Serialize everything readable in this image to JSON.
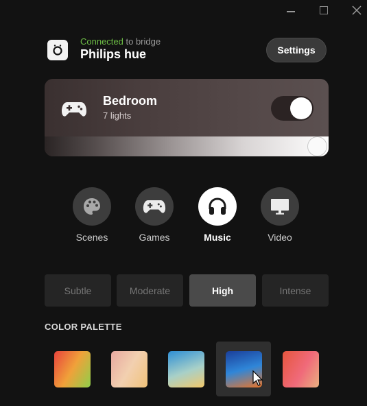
{
  "window": {
    "controls": [
      "minimize",
      "maximize",
      "close"
    ]
  },
  "header": {
    "connected_word": "Connected",
    "connected_suffix": " to bridge",
    "bridge_name": "Philips hue",
    "settings_label": "Settings",
    "bridge_icon": "bridge-icon"
  },
  "room": {
    "name": "Bedroom",
    "subtitle": "7 lights",
    "icon": "gamepad-icon",
    "power_on": true,
    "brightness": 1.0
  },
  "modes": [
    {
      "label": "Scenes",
      "icon": "palette-icon",
      "active": false
    },
    {
      "label": "Games",
      "icon": "gamepad-icon",
      "active": false
    },
    {
      "label": "Music",
      "icon": "headphones-icon",
      "active": true
    },
    {
      "label": "Video",
      "icon": "monitor-icon",
      "active": false
    }
  ],
  "intensity": [
    {
      "label": "Subtle",
      "active": false
    },
    {
      "label": "Moderate",
      "active": false
    },
    {
      "label": "High",
      "active": true
    },
    {
      "label": "Intense",
      "active": false
    }
  ],
  "palette": {
    "title": "COLOR PALETTE",
    "swatches": [
      {
        "colors": [
          "#e8443c",
          "#f0a13a",
          "#8fcf4a"
        ],
        "active": false
      },
      {
        "colors": [
          "#e7a8a0",
          "#f2d0b0",
          "#f0c27a"
        ],
        "active": false
      },
      {
        "colors": [
          "#2e8fd6",
          "#a8d0c8",
          "#f2c86a"
        ],
        "active": false
      },
      {
        "colors": [
          "#1b3f9a",
          "#2f86d8",
          "#e8752a"
        ],
        "active": true
      },
      {
        "colors": [
          "#e6563e",
          "#f06a7a",
          "#e9b080"
        ],
        "active": false
      }
    ]
  }
}
